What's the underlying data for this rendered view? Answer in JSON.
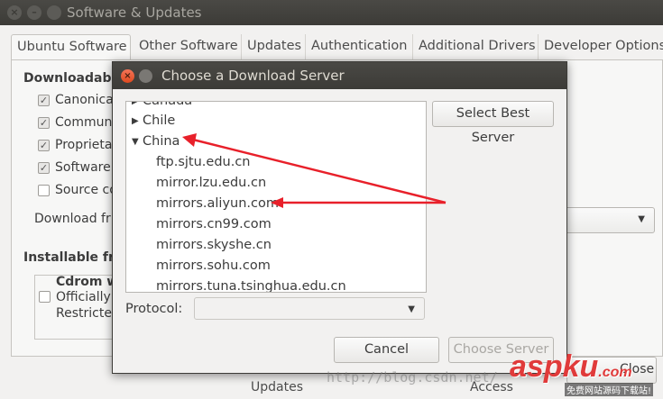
{
  "window": {
    "title": "Software & Updates",
    "tabs": [
      "Ubuntu Software",
      "Other Software",
      "Updates",
      "Authentication",
      "Additional Drivers",
      "Developer Options"
    ],
    "section_downloadable": "Downloadable",
    "options": [
      "Canonica",
      "Commun",
      "Proprieta",
      "Software",
      "Source co"
    ],
    "download_from_label": "Download fr",
    "section_installable": "Installable fro",
    "cdrom_title": "Cdrom w",
    "cdrom_line1": "Officially",
    "cdrom_line2": "Restricte",
    "close_button": "Close",
    "bottom_updates": "Updates",
    "bottom_access": "Access"
  },
  "dialog": {
    "title": "Choose a Download Server",
    "countries": {
      "canada": "Canada",
      "chile": "Chile",
      "china": "China"
    },
    "servers": [
      "ftp.sjtu.edu.cn",
      "mirror.lzu.edu.cn",
      "mirrors.aliyun.com",
      "mirrors.cn99.com",
      "mirrors.skyshe.cn",
      "mirrors.sohu.com",
      "mirrors.tuna.tsinghua.edu.cn"
    ],
    "select_best_button": "Select Best Server",
    "protocol_label": "Protocol:",
    "protocol_value": "",
    "cancel_button": "Cancel",
    "choose_button": "Choose Server"
  },
  "watermark": {
    "text": "http://blog.csdn.net/",
    "logo": "aspku",
    "logo_suffix": ".com",
    "logo_sub": "免费网站源码下载站!"
  },
  "colors": {
    "accent": "#f47421",
    "annotation_arrow": "#e8202a",
    "titlebar": "#3c3b37"
  }
}
